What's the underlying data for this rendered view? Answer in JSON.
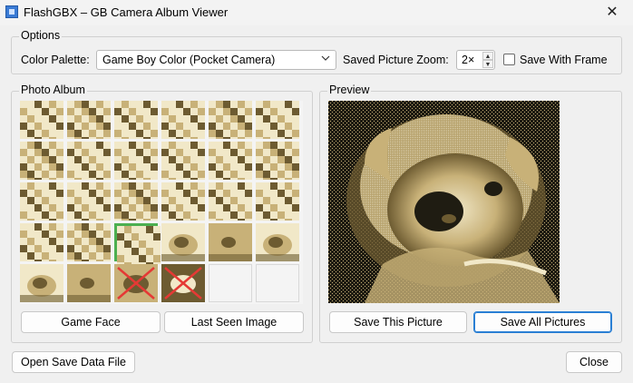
{
  "window": {
    "title": "FlashGBX – GB Camera Album Viewer",
    "close_glyph": "✕"
  },
  "options": {
    "label": "Options",
    "color_palette_label": "Color Palette:",
    "color_palette_value": "Game Boy Color (Pocket Camera)",
    "zoom_label": "Saved Picture Zoom:",
    "zoom_value": "2×",
    "save_with_frame_label": "Save With Frame",
    "save_with_frame_checked": false
  },
  "album": {
    "label": "Photo Album",
    "game_face_button": "Game Face",
    "last_seen_button": "Last Seen Image",
    "thumbnails": [
      {
        "state": "blurred",
        "tone": 0
      },
      {
        "state": "blurred",
        "tone": 1
      },
      {
        "state": "blurred",
        "tone": 2
      },
      {
        "state": "blurred",
        "tone": 0
      },
      {
        "state": "blurred",
        "tone": 1
      },
      {
        "state": "blurred",
        "tone": 2
      },
      {
        "state": "blurred",
        "tone": 1
      },
      {
        "state": "blurred",
        "tone": 2
      },
      {
        "state": "blurred",
        "tone": 0
      },
      {
        "state": "blurred",
        "tone": 2
      },
      {
        "state": "blurred",
        "tone": 0
      },
      {
        "state": "blurred",
        "tone": 1
      },
      {
        "state": "blurred",
        "tone": 2
      },
      {
        "state": "blurred",
        "tone": 0
      },
      {
        "state": "blurred",
        "tone": 1
      },
      {
        "state": "blurred",
        "tone": 0
      },
      {
        "state": "blurred",
        "tone": 2
      },
      {
        "state": "blurred",
        "tone": 0
      },
      {
        "state": "blurred",
        "tone": 0
      },
      {
        "state": "blurred",
        "tone": 1
      },
      {
        "state": "selected",
        "tone": 2
      },
      {
        "state": "photo",
        "tone": 1
      },
      {
        "state": "photo",
        "tone": 0
      },
      {
        "state": "photo",
        "tone": 2
      },
      {
        "state": "photo",
        "tone": 2
      },
      {
        "state": "photo",
        "tone": 0
      },
      {
        "state": "deleted",
        "tone": 1
      },
      {
        "state": "deleted",
        "tone": 2
      },
      {
        "state": "empty",
        "tone": 0
      },
      {
        "state": "empty",
        "tone": 0
      }
    ]
  },
  "preview": {
    "label": "Preview",
    "save_this_button": "Save This Picture",
    "save_all_button": "Save All Pictures"
  },
  "footer": {
    "open_save_button": "Open Save Data File",
    "close_button": "Close"
  },
  "colors": {
    "sepia_light": "#f1e8c8",
    "sepia_mid": "#c8b178",
    "sepia_dark": "#6d5b31",
    "sepia_black": "#1f1c12",
    "delete_red": "#e53935",
    "select_green": "#4caf50"
  }
}
